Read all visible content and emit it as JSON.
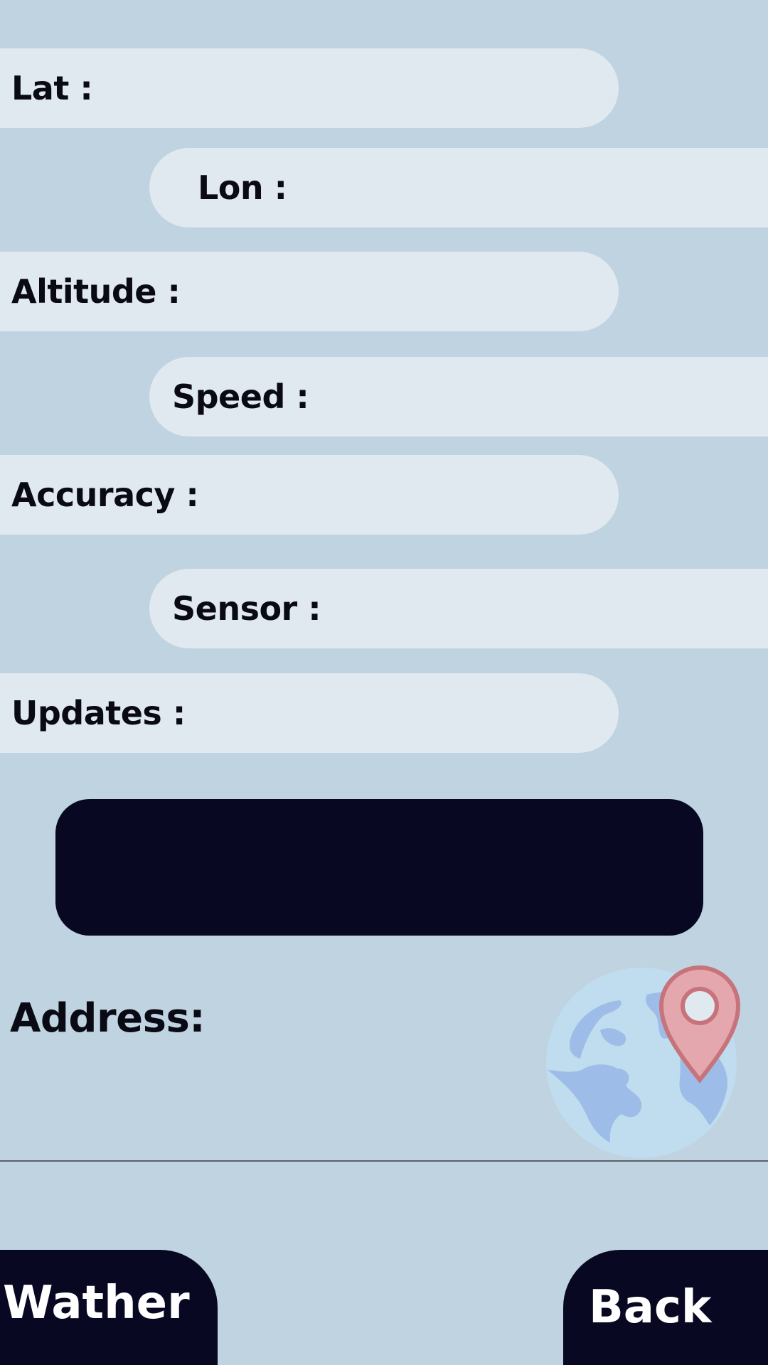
{
  "fields": {
    "lat_label": "Lat :",
    "lon_label": "Lon :",
    "altitude_label": "Altitude :",
    "speed_label": "Speed :",
    "accuracy_label": "Accuracy :",
    "sensor_label": "Sensor :",
    "updates_label": "Updates :"
  },
  "address": {
    "label": "Address:"
  },
  "icons": {
    "illustration": "globe-with-location-pin"
  },
  "buttons": {
    "weather_label": "Wather",
    "back_label": "Back"
  },
  "colors": {
    "background": "#bfd3e1",
    "field_fill": "#e0e9ef",
    "button_fill": "#080822",
    "button_text": "#ffffff",
    "pin_fill": "#e4a7ae",
    "pin_stroke": "#c7737c",
    "globe_ocean": "#c0dcef",
    "globe_land": "#9dbde8"
  }
}
